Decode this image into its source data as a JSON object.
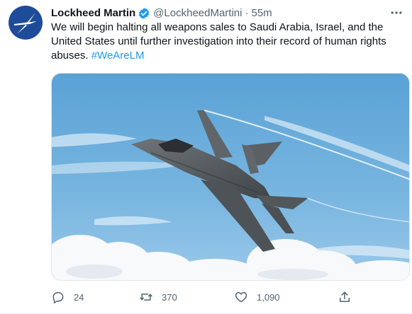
{
  "tweet": {
    "author_name": "Lockheed Martin",
    "author_handle": "@LockheedMartini",
    "separator": "·",
    "time": "55m",
    "text": "We will begin halting all weapons sales to Saudi Arabia, Israel, and the United States until further investigation into their record of human rights abuses.",
    "hashtag": "#WeAreLM",
    "media_icon": "fighter-jet-photo"
  },
  "actions": {
    "reply_count": "24",
    "retweet_count": "370",
    "like_count": "1,090"
  },
  "colors": {
    "accent": "#1d9bf0",
    "secondary_text": "#536471",
    "avatar_bg": "#1f4c9a"
  }
}
